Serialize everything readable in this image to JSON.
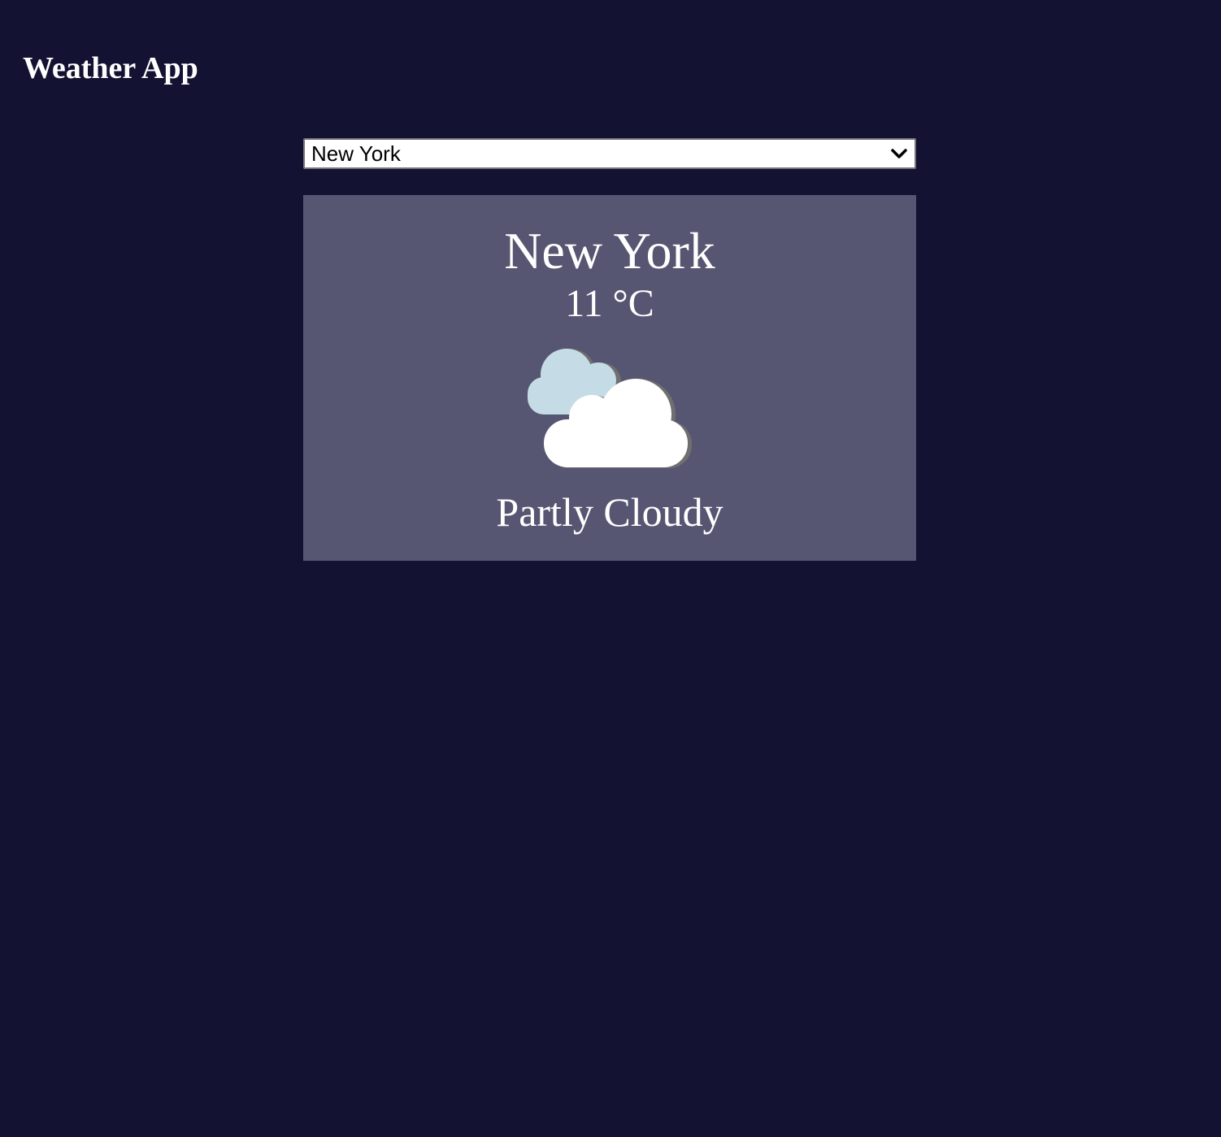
{
  "app": {
    "title": "Weather App"
  },
  "city_select": {
    "selected": "New York",
    "chevron_icon": "chevron-down-icon"
  },
  "weather_card": {
    "city": "New York",
    "temperature": "11 °C",
    "icon": "partly-cloudy-icon",
    "condition": "Partly Cloudy"
  },
  "colors": {
    "page_background": "#131232",
    "card_background": "#575672",
    "text": "#ffffff",
    "back_cloud": "#c5dce6",
    "front_cloud": "#ffffff",
    "cloud_shadow": "#6f6f6f"
  }
}
